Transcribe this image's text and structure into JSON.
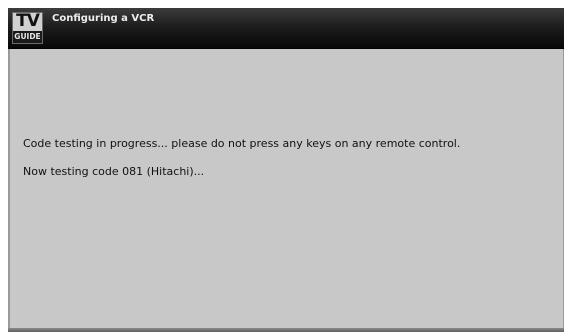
{
  "header": {
    "logo": {
      "top_text": "TV",
      "bottom_text": "GUIDE"
    },
    "title": "Configuring a VCR"
  },
  "main": {
    "status_message": "Code testing in progress... please do not press any keys on any remote control.",
    "testing_message": "Now testing code 081 (Hitachi)..."
  },
  "colors": {
    "header_bar": "#141414",
    "content_background": "#c8c8c8",
    "title_text": "#ededed",
    "body_text": "#111111"
  }
}
